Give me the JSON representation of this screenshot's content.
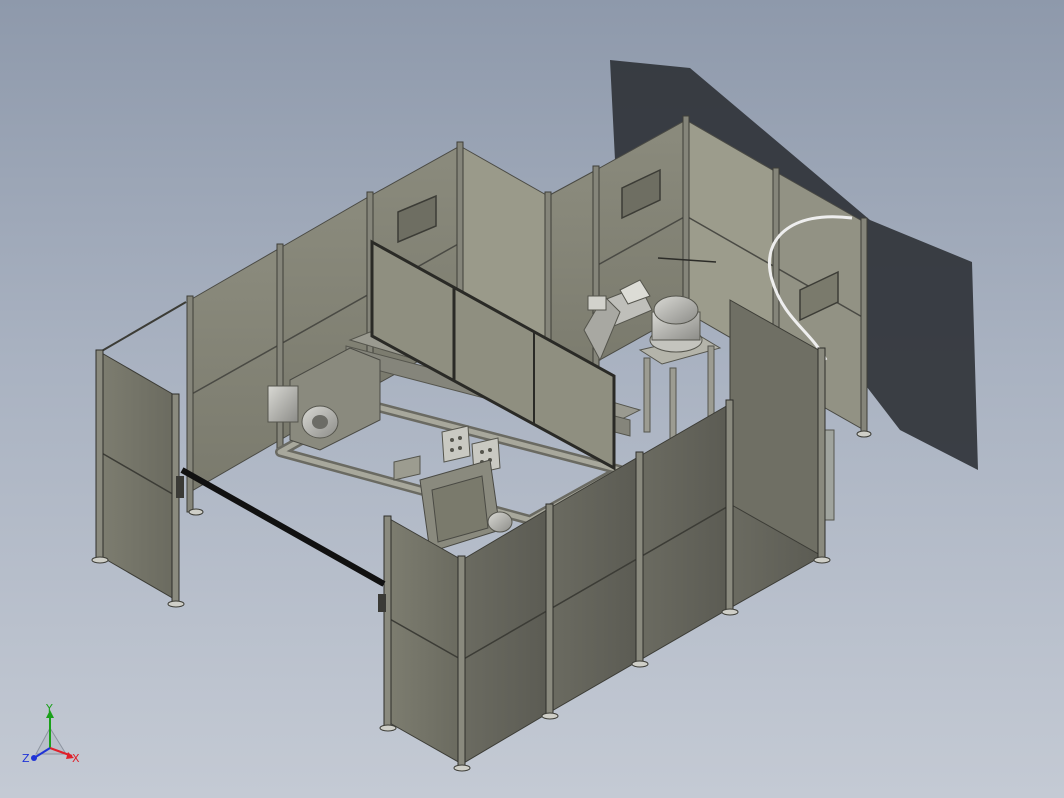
{
  "triad": {
    "y_label": "Y",
    "x_label": "X",
    "z_label": "Z",
    "colors": {
      "x": "#e0202a",
      "y": "#1aa01a",
      "z": "#1f33d6"
    }
  },
  "colors": {
    "background_top": "#8e99ab",
    "background_bottom": "#c4cad4",
    "panel": "#7a7a6c",
    "panel_light": "#8e8e80",
    "frame": "#55554d",
    "shadow": "#2d3035"
  }
}
